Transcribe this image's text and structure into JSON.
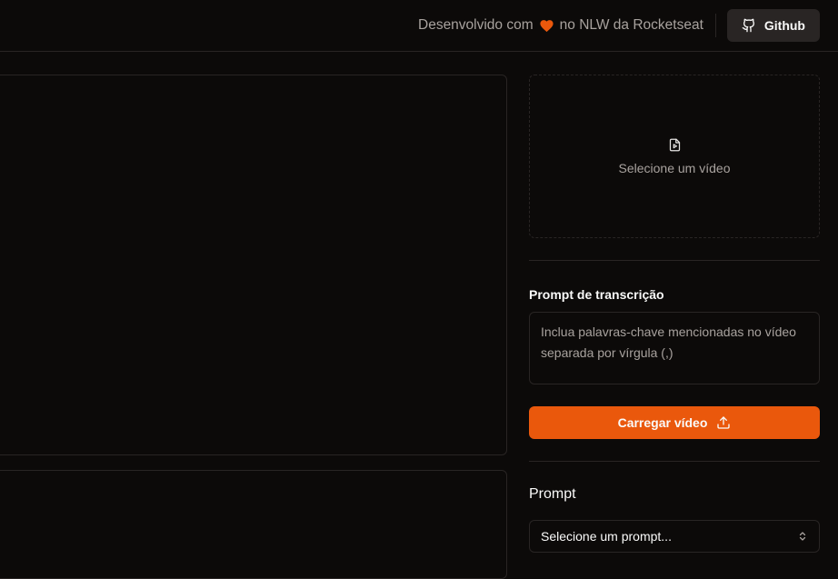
{
  "header": {
    "credit_prefix": "Desenvolvido com",
    "credit_suffix": "no NLW da Rocketseat",
    "heart_icon": "heart-icon",
    "github_label": "Github",
    "github_icon": "github-icon"
  },
  "upload_area": {
    "label": "Selecione um vídeo",
    "icon": "file-video-icon"
  },
  "transcription": {
    "label": "Prompt de transcrição",
    "placeholder": "Inclua palavras-chave mencionadas no vídeo separada por vírgula (,)"
  },
  "upload_button": {
    "label": "Carregar vídeo",
    "icon": "upload-icon"
  },
  "prompt": {
    "title": "Prompt",
    "select_value": "Selecione um prompt...",
    "select_icon": "chevrons-up-down-icon"
  },
  "colors": {
    "background": "#0c0a09",
    "border": "#292524",
    "muted_text": "#a8a29e",
    "accent": "#ea580c"
  }
}
